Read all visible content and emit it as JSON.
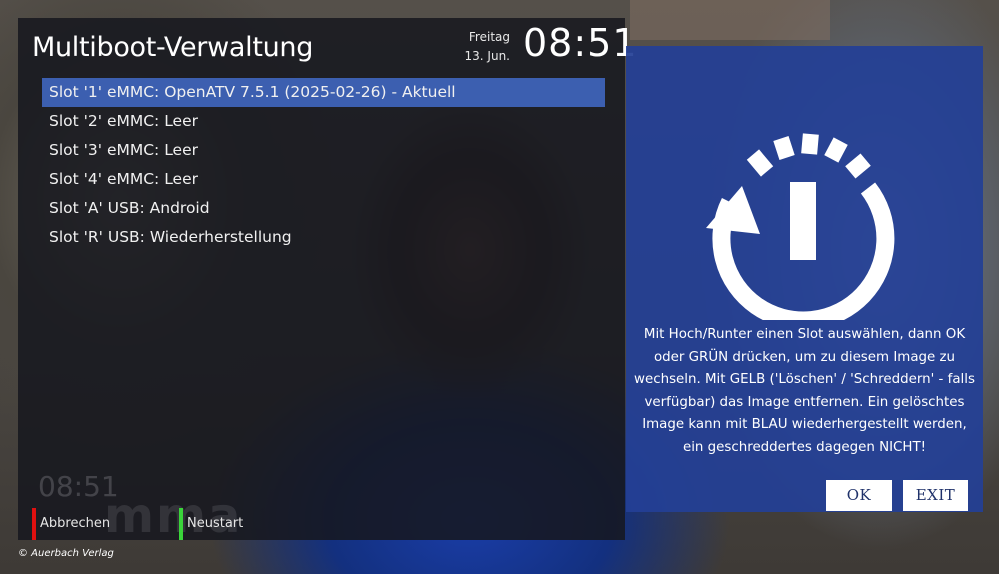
{
  "header": {
    "title": "Multiboot-Verwaltung",
    "weekday": "Freitag",
    "date": "13. Jun.",
    "time": "08:51"
  },
  "slots": [
    "Slot '1' eMMC: OpenATV 7.5.1 (2025-02-26)  -  Aktuell",
    "Slot '2' eMMC: Leer",
    "Slot '3' eMMC: Leer",
    "Slot '4' eMMC: Leer",
    "Slot 'A' USB: Android",
    "Slot 'R' USB: Wiederherstellung"
  ],
  "background": {
    "ghost_time": "08:51",
    "ghost_logo": "mma"
  },
  "footer": {
    "red_label": "Abbrechen",
    "green_label": "Neustart"
  },
  "info": {
    "icon": "power-restart-icon",
    "help_text": "Mit Hoch/Runter einen Slot auswählen, dann OK oder GRÜN drücken, um zu diesem Image zu wechseln. Mit GELB ('Löschen' / 'Schreddern' - falls verfügbar) das Image entfernen. Ein gelöschtes Image kann mit BLAU wiederhergestellt werden, ein geschreddertes dagegen NICHT!",
    "ok_label": "OK",
    "exit_label": "EXIT"
  },
  "copyright": "© Auerbach Verlag",
  "colors": {
    "selection": "#3c5fb0",
    "info_panel": "#243f96",
    "red_key": "#e01010",
    "green_key": "#3ad43a"
  }
}
